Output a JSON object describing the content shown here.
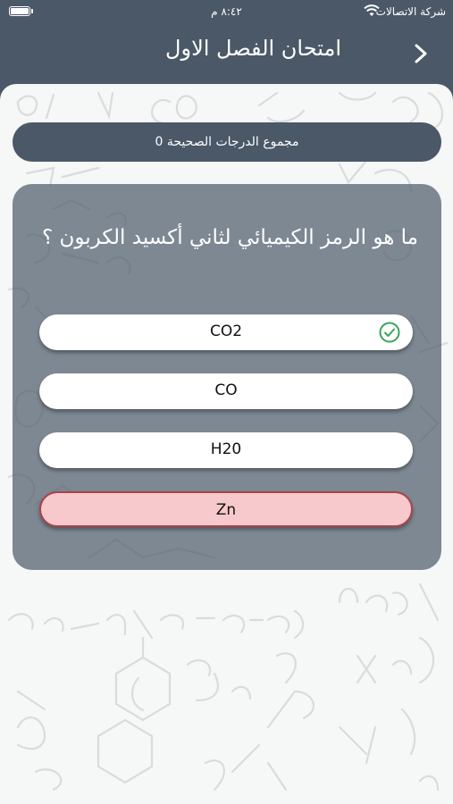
{
  "status_bar": {
    "carrier": "شركة الاتصالات",
    "time": "٨:٤٢ م"
  },
  "nav": {
    "title": "امتحان الفصل الاول",
    "back_icon": "chevron-right-icon"
  },
  "score": {
    "label": "مجموع الدرجات الصحيحة 0",
    "value": 0
  },
  "question": {
    "text": "ما هو الرمز الكيميائي لثاني أكسيد الكربون ؟"
  },
  "answers": [
    {
      "label": "CO2",
      "state": "correct",
      "icon": "check-circle-icon"
    },
    {
      "label": "CO",
      "state": "default"
    },
    {
      "label": "H20",
      "state": "default"
    },
    {
      "label": "Zn",
      "state": "wrong"
    }
  ],
  "colors": {
    "header": "#4a5868",
    "background": "#f6f7f7",
    "correct_icon": "#3aa55a",
    "wrong_fill": "#f8c9cc",
    "wrong_border": "#a84449"
  }
}
